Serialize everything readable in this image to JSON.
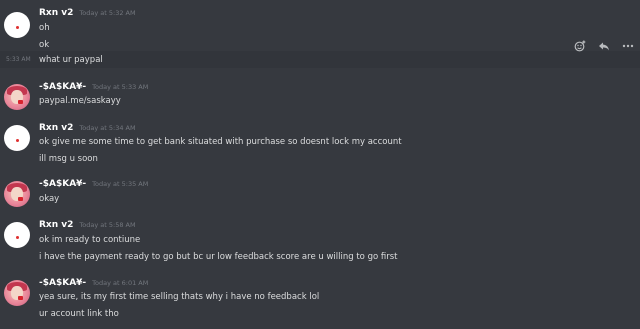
{
  "messages": [
    {
      "username": "Rxn v2",
      "timestamp": "Today at 5:32 AM",
      "avatar": "white-avatar",
      "lines": [
        "oh",
        "ok"
      ]
    },
    {
      "side_timestamp": "5:33 AM",
      "text": "what ur paypal"
    },
    {
      "username": "-$A$KA¥-",
      "timestamp": "Today at 5:33 AM",
      "avatar": "pink-avatar",
      "lines": [
        "paypal.me/saskayy"
      ]
    },
    {
      "username": "Rxn v2",
      "timestamp": "Today at 5:34 AM",
      "avatar": "white-avatar",
      "lines": [
        "ok give me some time to get bank situated with purchase so doesnt lock my account",
        "ill msg u soon"
      ]
    },
    {
      "username": "-$A$KA¥-",
      "timestamp": "Today at 5:35 AM",
      "avatar": "pink-avatar",
      "lines": [
        "okay"
      ]
    },
    {
      "username": "Rxn v2",
      "timestamp": "Today at 5:58 AM",
      "avatar": "white-avatar",
      "lines": [
        "ok im ready to contiune",
        "i have the payment ready to go but bc ur low feedback score are u willing to go first"
      ]
    },
    {
      "username": "-$A$KA¥-",
      "timestamp": "Today at 6:01 AM",
      "avatar": "pink-avatar",
      "lines": [
        "yea sure, its my first time selling thats why i have no feedback lol",
        "ur account link tho"
      ]
    }
  ],
  "toolbar": {
    "icons": [
      "add-reaction-icon",
      "reply-icon",
      "more-options-icon"
    ]
  },
  "colors": {
    "background": "#36393f",
    "hover": "#32353b",
    "username": "#ffffff",
    "text": "#dcddde",
    "timestamp": "#72767d"
  }
}
